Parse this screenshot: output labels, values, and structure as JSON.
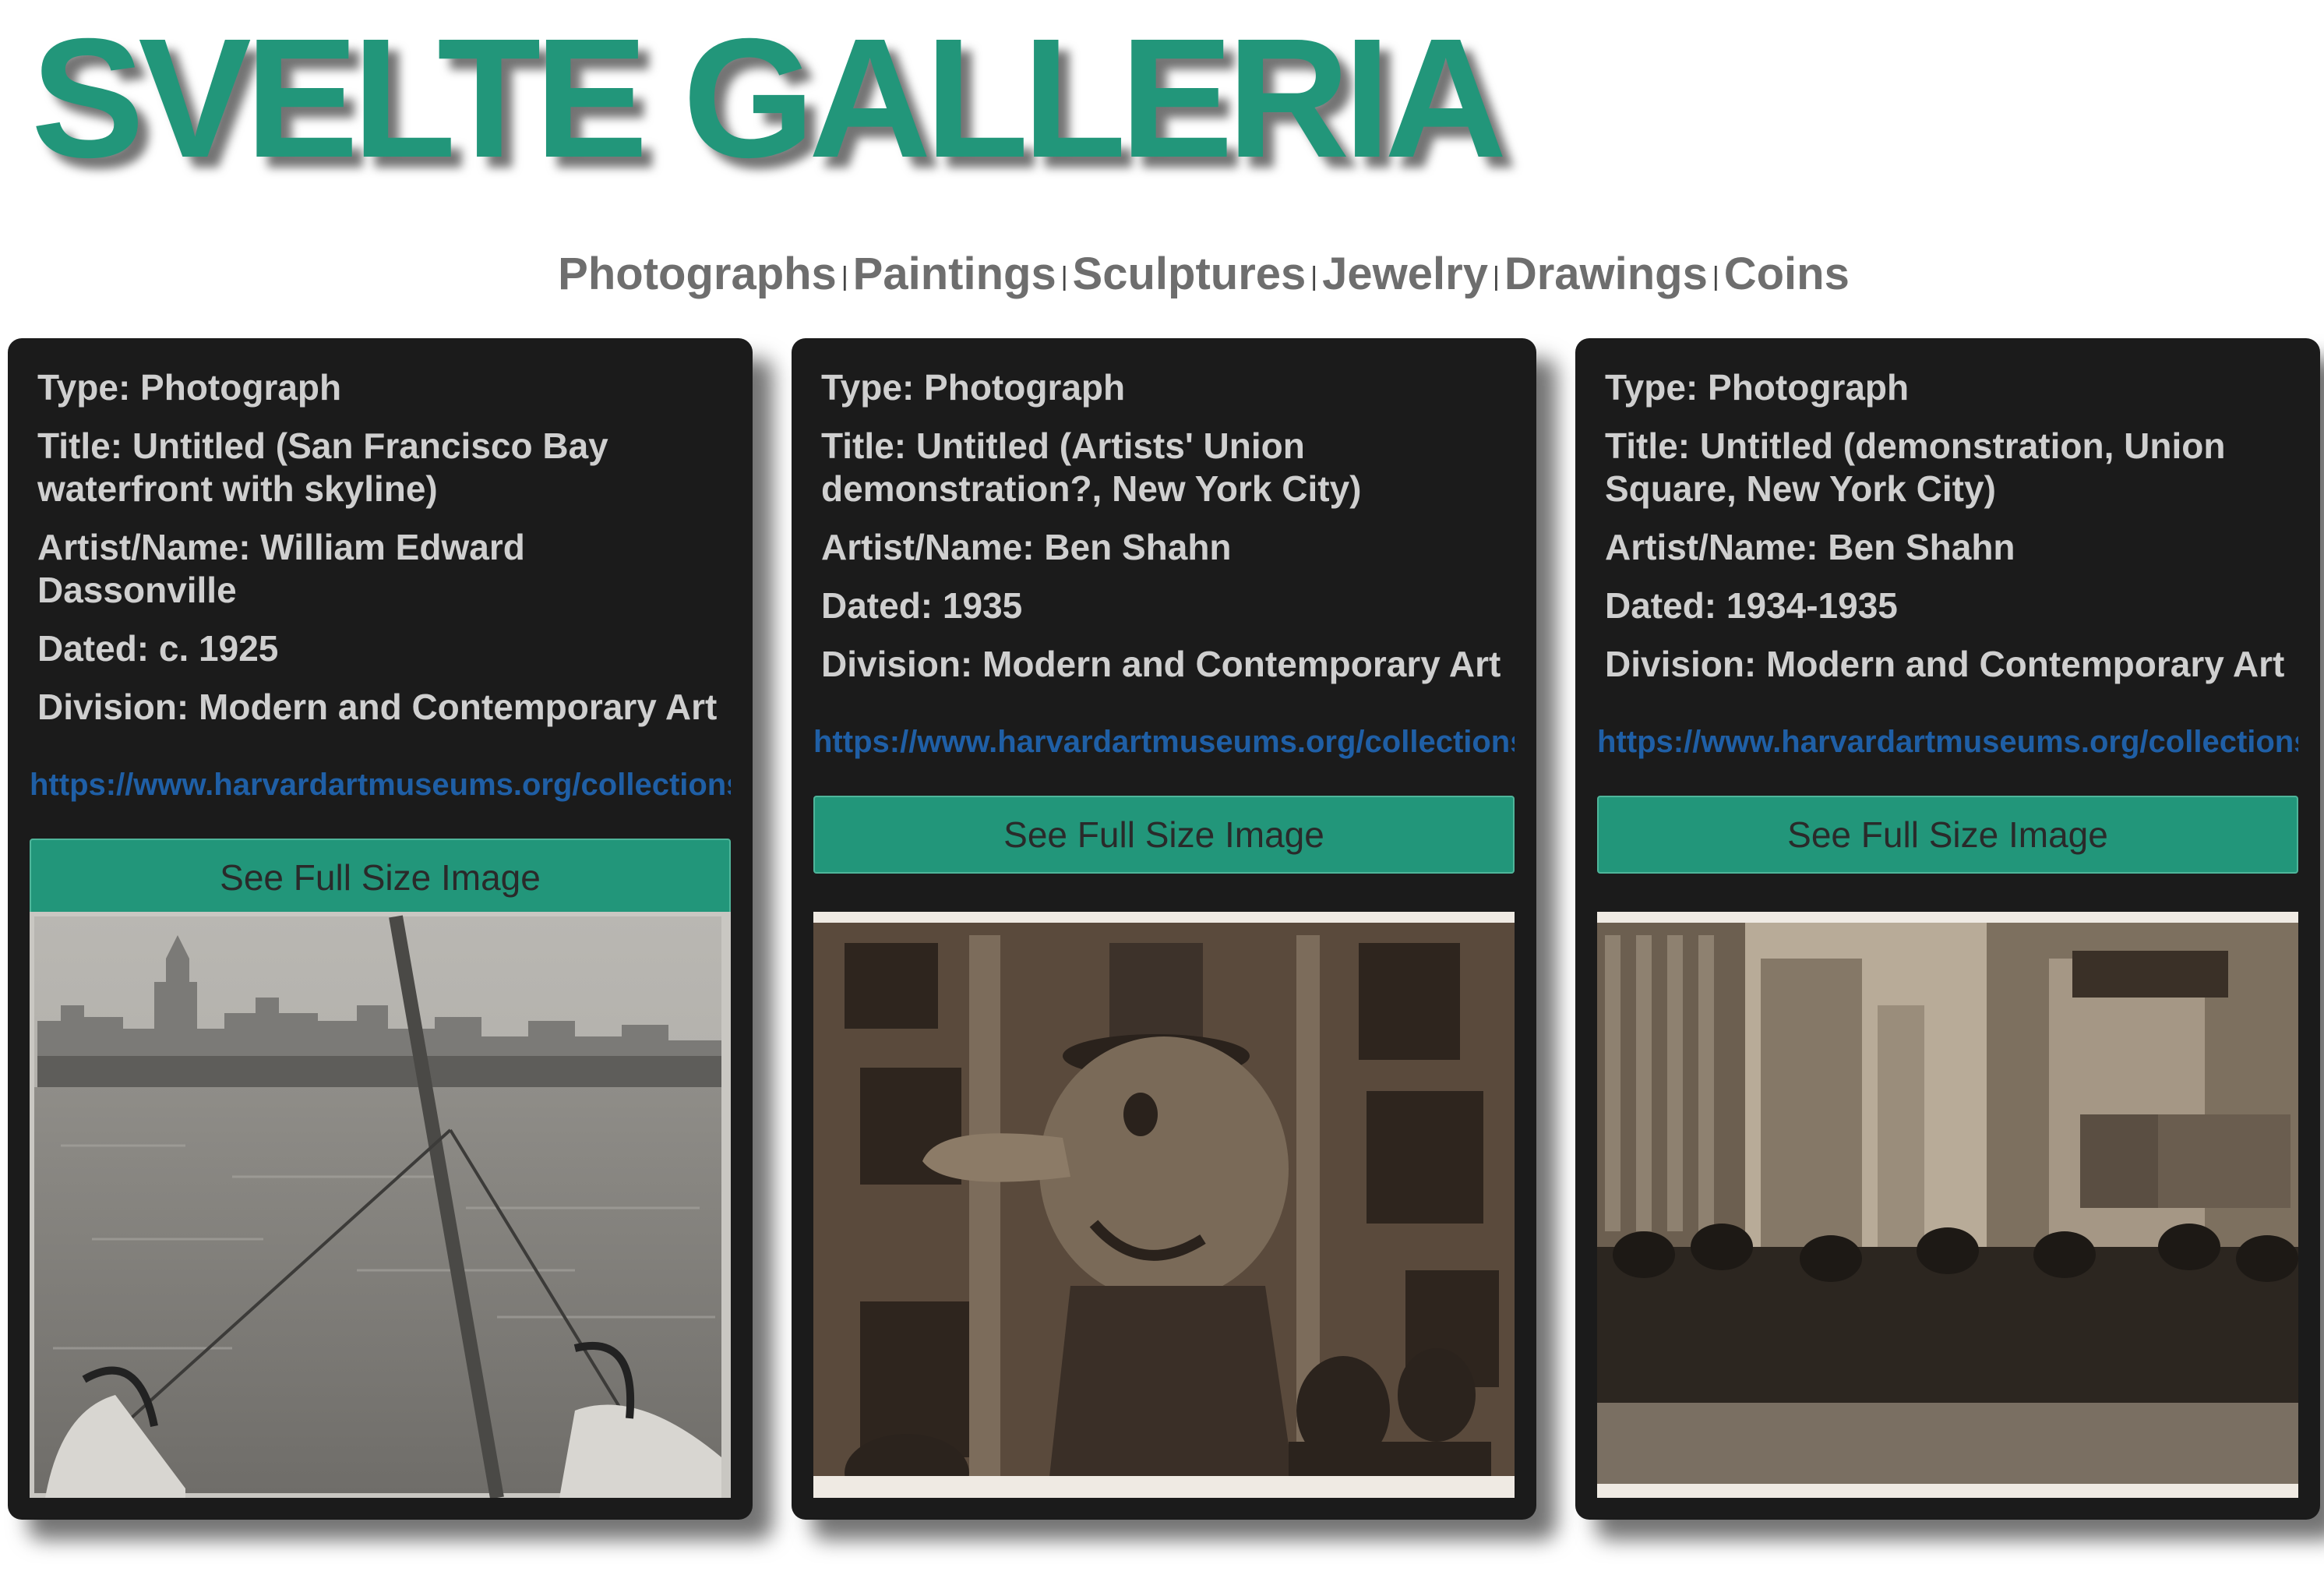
{
  "site": {
    "title": "SVELTE GALLERIA"
  },
  "nav": {
    "items": [
      "Photographs",
      "Paintings",
      "Sculptures",
      "Jewelry",
      "Drawings",
      "Coins"
    ],
    "separator": "|"
  },
  "cards": [
    {
      "type": "Type: Photograph",
      "title": "Title: Untitled (San Francisco Bay waterfront with skyline)",
      "artist": "Artist/Name: William Edward Dassonville",
      "dated": "Dated: c. 1925",
      "division": "Division: Modern and Contemporary Art",
      "link": "https://www.harvardartmuseums.org/collections",
      "button": "See Full Size Image"
    },
    {
      "type": "Type: Photograph",
      "title": "Title: Untitled (Artists' Union demonstration?, New York City)",
      "artist": "Artist/Name: Ben Shahn",
      "dated": "Dated: 1935",
      "division": "Division: Modern and Contemporary Art",
      "link": "https://www.harvardartmuseums.org/collections",
      "button": "See Full Size Image"
    },
    {
      "type": "Type: Photograph",
      "title": "Title: Untitled (demonstration, Union Square, New York City)",
      "artist": "Artist/Name: Ben Shahn",
      "dated": "Dated: 1934-1935",
      "division": "Division: Modern and Contemporary Art",
      "link": "https://www.harvardartmuseums.org/collections",
      "button": "See Full Size Image"
    }
  ],
  "colors": {
    "accent": "#22967a",
    "card_bg": "#1b1b1b",
    "link": "#1f5fa6",
    "nav_text": "#6e6e6e"
  }
}
